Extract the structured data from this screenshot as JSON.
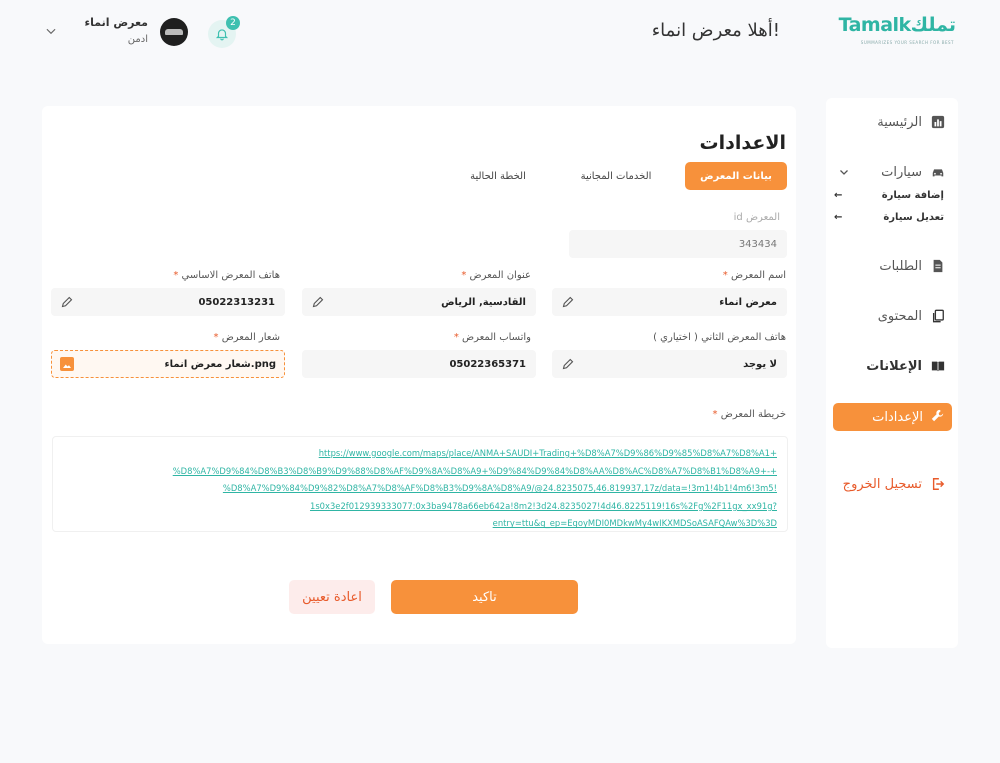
{
  "header": {
    "logo_brand": "Tamalkتملك",
    "logo_tagline": "SUMMARIZES YOUR SEARCH FOR BEST",
    "welcome": "أهلا معرض انماء!",
    "notification_count": "2",
    "user_name": "معرض انماء",
    "user_role": "ادمن"
  },
  "sidebar": {
    "home": "الرئيسية",
    "cars": "سيارات",
    "add_car": "إضافة سيارة",
    "edit_car": "تعديل سيارة",
    "orders": "الطلبات",
    "content": "المحتوى",
    "ads": "الإعلانات",
    "settings": "الإعدادات",
    "logout": "تسجيل الخروج",
    "arrow": "←"
  },
  "main": {
    "title": "الاعدادات",
    "tabs": [
      "بيانات المعرض",
      "الخدمات المجانية",
      "الخطة الحالية"
    ],
    "id_label": "المعرض id",
    "id_value": "343434",
    "fields": {
      "name_label": "اسم المعرض",
      "name_value": "معرض انماء",
      "address_label": "عنوان المعرض",
      "address_value": "القادسية, الرياض",
      "phone_label": "هاتف المعرض الاساسي",
      "phone_value": "05022313231",
      "phone2_label": "هاتف المعرض الثاني ( اختياري )",
      "phone2_value": "لا يوجد",
      "whatsapp_label": "واتساب المعرض",
      "whatsapp_value": "05022365371",
      "logo_label": "شعار المعرض",
      "logo_value": "شعار معرض انماء.png",
      "map_label": "خريطة المعرض",
      "map_lines": [
        "https://www.google.com/maps/place/ANMA+SAUDI+Trading+%D8%A7%D9%86%D9%85%D8%A7%D8%A1+",
        "%D8%A7%D9%84%D8%B3%D8%B9%D9%88%D8%AF%D9%8A%D8%A9+%D9%84%D9%84%D8%AA%D8%AC%D8%A7%D8%B1%D8%A9+-+",
        "%D8%A7%D9%84%D9%82%D8%A7%D8%AF%D8%B3%D9%8A%D8%A9/@24.8235075,46.819937,17z/data=!3m1!4b1!4m6!3m5!",
        "1s0x3e2f012939333077:0x3ba9478a66eb642a!8m2!3d24.8235027!4d46.8225119!16s%2Fg%2F11gx_xx91g?",
        "entry=ttu&g_ep=EgoyMDI0MDkwMy4wIKXMDSoASAFQAw%3D%3D"
      ]
    },
    "required_mark": "*",
    "confirm": "تاكيد",
    "reset": "اعادة تعيين"
  },
  "colors": {
    "accent": "#f7913b",
    "teal": "#2fb5a4",
    "danger": "#e85a2a"
  }
}
